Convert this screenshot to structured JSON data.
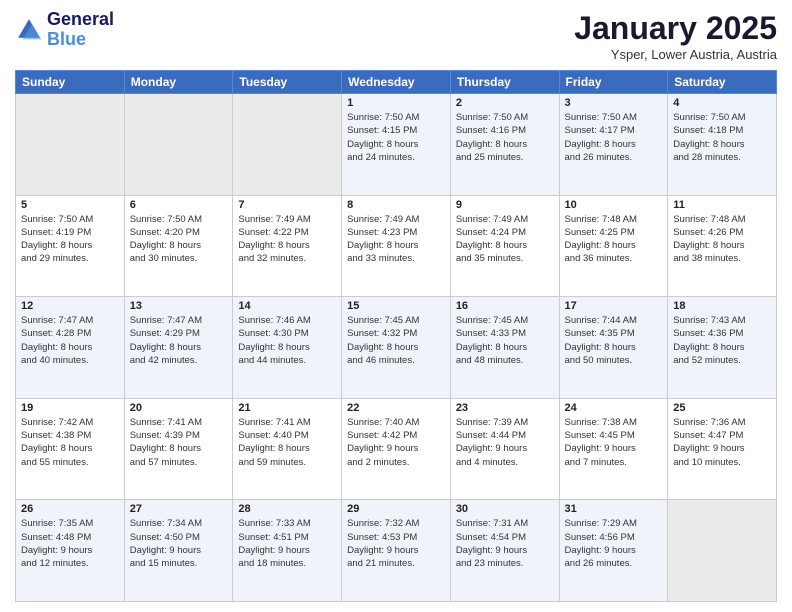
{
  "header": {
    "logo_line1": "General",
    "logo_line2": "Blue",
    "month": "January 2025",
    "location": "Ysper, Lower Austria, Austria"
  },
  "weekdays": [
    "Sunday",
    "Monday",
    "Tuesday",
    "Wednesday",
    "Thursday",
    "Friday",
    "Saturday"
  ],
  "weeks": [
    [
      {
        "day": "",
        "info": ""
      },
      {
        "day": "",
        "info": ""
      },
      {
        "day": "",
        "info": ""
      },
      {
        "day": "1",
        "info": "Sunrise: 7:50 AM\nSunset: 4:15 PM\nDaylight: 8 hours\nand 24 minutes."
      },
      {
        "day": "2",
        "info": "Sunrise: 7:50 AM\nSunset: 4:16 PM\nDaylight: 8 hours\nand 25 minutes."
      },
      {
        "day": "3",
        "info": "Sunrise: 7:50 AM\nSunset: 4:17 PM\nDaylight: 8 hours\nand 26 minutes."
      },
      {
        "day": "4",
        "info": "Sunrise: 7:50 AM\nSunset: 4:18 PM\nDaylight: 8 hours\nand 28 minutes."
      }
    ],
    [
      {
        "day": "5",
        "info": "Sunrise: 7:50 AM\nSunset: 4:19 PM\nDaylight: 8 hours\nand 29 minutes."
      },
      {
        "day": "6",
        "info": "Sunrise: 7:50 AM\nSunset: 4:20 PM\nDaylight: 8 hours\nand 30 minutes."
      },
      {
        "day": "7",
        "info": "Sunrise: 7:49 AM\nSunset: 4:22 PM\nDaylight: 8 hours\nand 32 minutes."
      },
      {
        "day": "8",
        "info": "Sunrise: 7:49 AM\nSunset: 4:23 PM\nDaylight: 8 hours\nand 33 minutes."
      },
      {
        "day": "9",
        "info": "Sunrise: 7:49 AM\nSunset: 4:24 PM\nDaylight: 8 hours\nand 35 minutes."
      },
      {
        "day": "10",
        "info": "Sunrise: 7:48 AM\nSunset: 4:25 PM\nDaylight: 8 hours\nand 36 minutes."
      },
      {
        "day": "11",
        "info": "Sunrise: 7:48 AM\nSunset: 4:26 PM\nDaylight: 8 hours\nand 38 minutes."
      }
    ],
    [
      {
        "day": "12",
        "info": "Sunrise: 7:47 AM\nSunset: 4:28 PM\nDaylight: 8 hours\nand 40 minutes."
      },
      {
        "day": "13",
        "info": "Sunrise: 7:47 AM\nSunset: 4:29 PM\nDaylight: 8 hours\nand 42 minutes."
      },
      {
        "day": "14",
        "info": "Sunrise: 7:46 AM\nSunset: 4:30 PM\nDaylight: 8 hours\nand 44 minutes."
      },
      {
        "day": "15",
        "info": "Sunrise: 7:45 AM\nSunset: 4:32 PM\nDaylight: 8 hours\nand 46 minutes."
      },
      {
        "day": "16",
        "info": "Sunrise: 7:45 AM\nSunset: 4:33 PM\nDaylight: 8 hours\nand 48 minutes."
      },
      {
        "day": "17",
        "info": "Sunrise: 7:44 AM\nSunset: 4:35 PM\nDaylight: 8 hours\nand 50 minutes."
      },
      {
        "day": "18",
        "info": "Sunrise: 7:43 AM\nSunset: 4:36 PM\nDaylight: 8 hours\nand 52 minutes."
      }
    ],
    [
      {
        "day": "19",
        "info": "Sunrise: 7:42 AM\nSunset: 4:38 PM\nDaylight: 8 hours\nand 55 minutes."
      },
      {
        "day": "20",
        "info": "Sunrise: 7:41 AM\nSunset: 4:39 PM\nDaylight: 8 hours\nand 57 minutes."
      },
      {
        "day": "21",
        "info": "Sunrise: 7:41 AM\nSunset: 4:40 PM\nDaylight: 8 hours\nand 59 minutes."
      },
      {
        "day": "22",
        "info": "Sunrise: 7:40 AM\nSunset: 4:42 PM\nDaylight: 9 hours\nand 2 minutes."
      },
      {
        "day": "23",
        "info": "Sunrise: 7:39 AM\nSunset: 4:44 PM\nDaylight: 9 hours\nand 4 minutes."
      },
      {
        "day": "24",
        "info": "Sunrise: 7:38 AM\nSunset: 4:45 PM\nDaylight: 9 hours\nand 7 minutes."
      },
      {
        "day": "25",
        "info": "Sunrise: 7:36 AM\nSunset: 4:47 PM\nDaylight: 9 hours\nand 10 minutes."
      }
    ],
    [
      {
        "day": "26",
        "info": "Sunrise: 7:35 AM\nSunset: 4:48 PM\nDaylight: 9 hours\nand 12 minutes."
      },
      {
        "day": "27",
        "info": "Sunrise: 7:34 AM\nSunset: 4:50 PM\nDaylight: 9 hours\nand 15 minutes."
      },
      {
        "day": "28",
        "info": "Sunrise: 7:33 AM\nSunset: 4:51 PM\nDaylight: 9 hours\nand 18 minutes."
      },
      {
        "day": "29",
        "info": "Sunrise: 7:32 AM\nSunset: 4:53 PM\nDaylight: 9 hours\nand 21 minutes."
      },
      {
        "day": "30",
        "info": "Sunrise: 7:31 AM\nSunset: 4:54 PM\nDaylight: 9 hours\nand 23 minutes."
      },
      {
        "day": "31",
        "info": "Sunrise: 7:29 AM\nSunset: 4:56 PM\nDaylight: 9 hours\nand 26 minutes."
      },
      {
        "day": "",
        "info": ""
      }
    ]
  ]
}
